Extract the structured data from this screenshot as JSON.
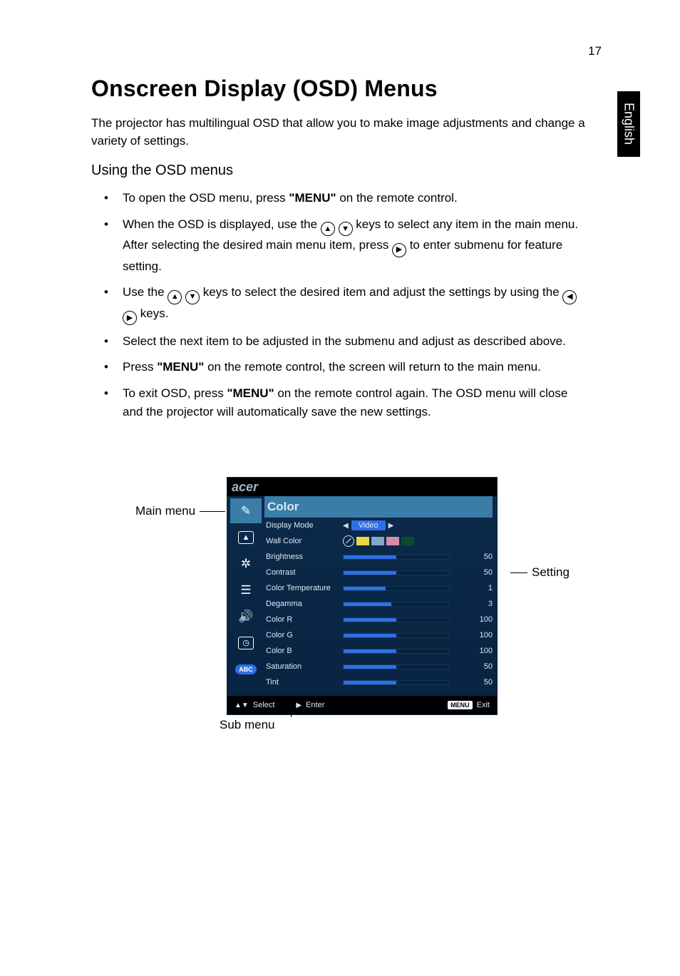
{
  "page_number": "17",
  "side_tab": "English",
  "heading": "Onscreen Display (OSD) Menus",
  "intro": "The projector has multilingual OSD that allow you to make image adjustments and change a variety of settings.",
  "subheading": "Using the OSD menus",
  "bullets": {
    "b1a": "To open the OSD menu, press ",
    "b1menu": "\"MENU\"",
    "b1b": " on the remote control.",
    "b2a": "When the OSD is displayed, use the ",
    "b2b": " keys to select any item in the main menu. After selecting the desired main menu item, press ",
    "b2c": " to enter submenu for feature setting.",
    "b3a": "Use the ",
    "b3b": " keys to select the desired item and adjust the settings by using the ",
    "b3c": " keys.",
    "b4": "Select the next item to be adjusted in the submenu and adjust as described above.",
    "b5a": "Press ",
    "b5menu": "\"MENU\"",
    "b5b": " on the remote control, the screen will return to the main menu.",
    "b6a": "To exit OSD, press ",
    "b6menu": "\"MENU\"",
    "b6b": " on the remote control again. The OSD menu will close and the projector will automatically save the new settings."
  },
  "labels": {
    "main": "Main menu",
    "setting": "Setting",
    "sub": "Sub menu"
  },
  "osd": {
    "logo": "acer",
    "title": "Color",
    "side_icons": [
      "brush-icon",
      "picture-icon",
      "gear-icon",
      "sliders-icon",
      "speaker-icon",
      "clock-icon",
      "abc-icon"
    ],
    "rows": [
      {
        "name": "Display Mode",
        "type": "mode",
        "value": "Video"
      },
      {
        "name": "Wall Color",
        "type": "swatch"
      },
      {
        "name": "Brightness",
        "type": "slider",
        "value": 50,
        "pct": 50
      },
      {
        "name": "Contrast",
        "type": "slider",
        "value": 50,
        "pct": 50
      },
      {
        "name": "Color Temperature",
        "type": "slider",
        "value": 1,
        "pct": 40
      },
      {
        "name": "Degamma",
        "type": "slider",
        "value": 3,
        "pct": 45
      },
      {
        "name": "Color R",
        "type": "slider",
        "value": 100,
        "pct": 50
      },
      {
        "name": "Color G",
        "type": "slider",
        "value": 100,
        "pct": 50
      },
      {
        "name": "Color B",
        "type": "slider",
        "value": 100,
        "pct": 50
      },
      {
        "name": "Saturation",
        "type": "slider",
        "value": 50,
        "pct": 50
      },
      {
        "name": "Tint",
        "type": "slider",
        "value": 50,
        "pct": 50
      }
    ],
    "footer": {
      "select": "Select",
      "enter": "Enter",
      "menu_badge": "MENU",
      "exit": "Exit"
    }
  }
}
